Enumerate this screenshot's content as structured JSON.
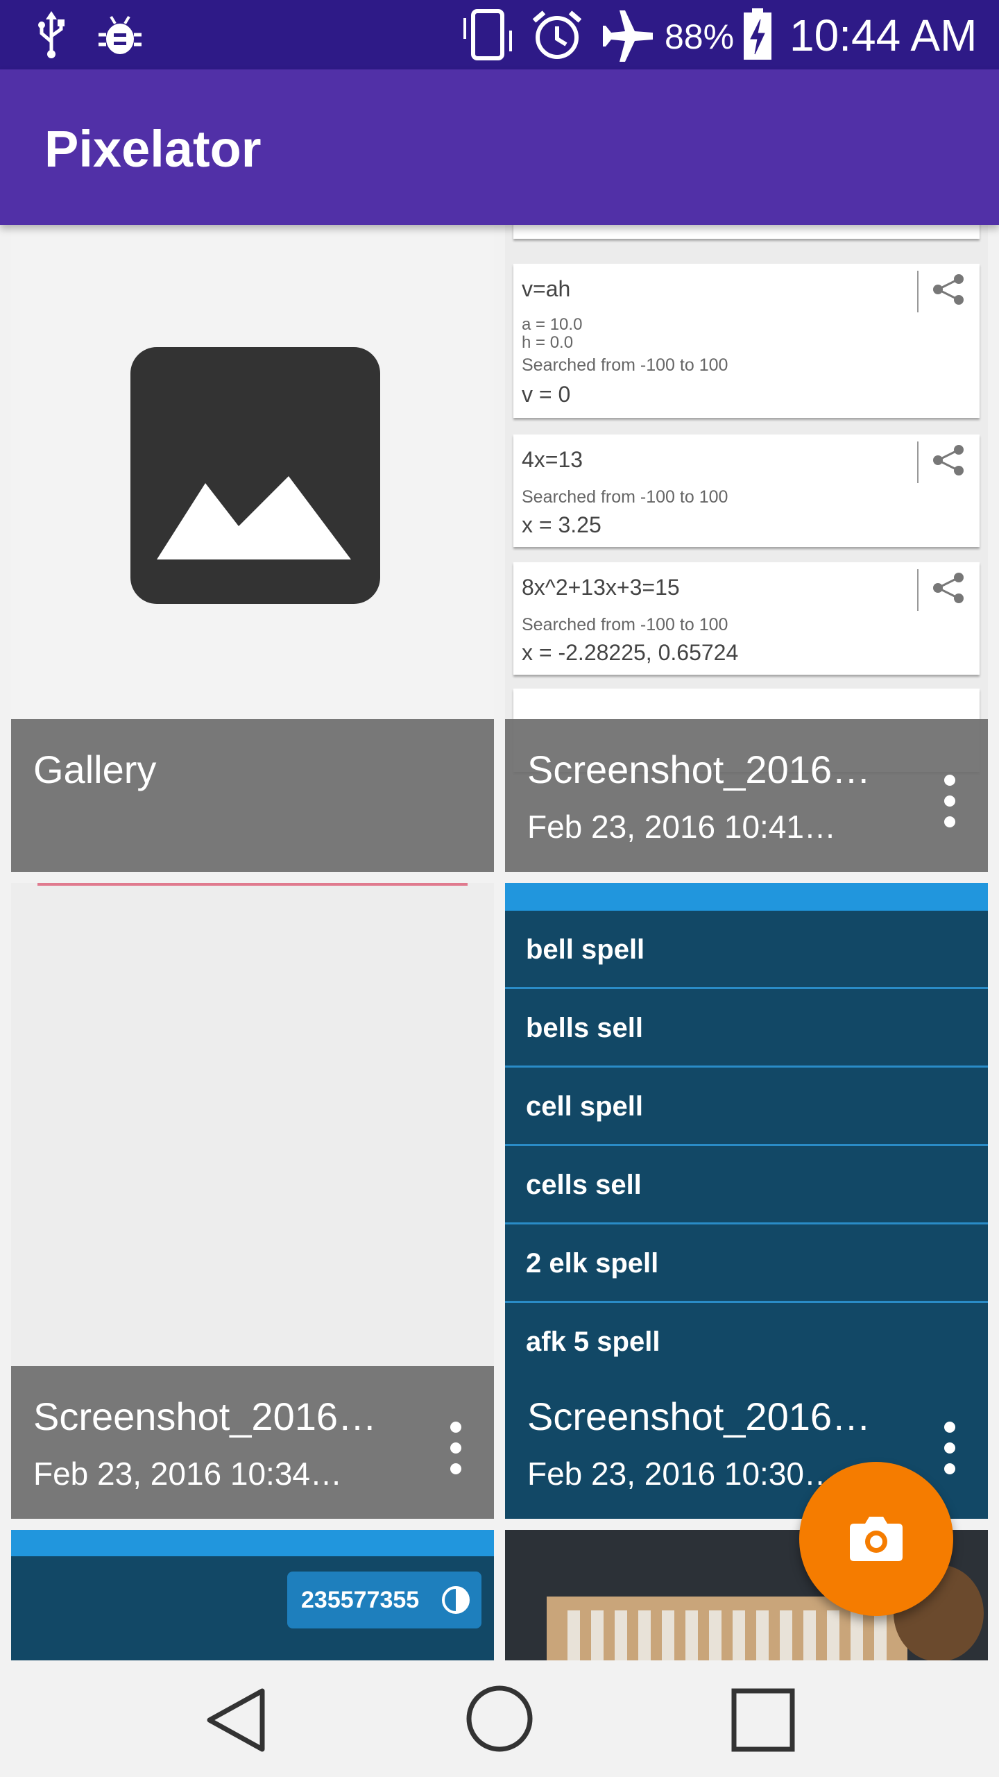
{
  "status_bar": {
    "battery": "88%",
    "time": "10:44 AM",
    "icons": [
      "usb-icon",
      "debug-icon",
      "vibrate-icon",
      "alarm-icon",
      "airplane-icon",
      "battery-charging-icon"
    ]
  },
  "app_bar": {
    "title": "Pixelator"
  },
  "gallery_tile": {
    "label": "Gallery",
    "icon": "image-icon"
  },
  "tiles": [
    {
      "title": "Screenshot_2016…",
      "date": "Feb 23, 2016 10:41…",
      "preview": {
        "cards": [
          {
            "equation": "v=ah",
            "vars": [
              "a = 10.0",
              "h = 0.0"
            ],
            "range": "Searched from -100 to 100",
            "result": "v = 0"
          },
          {
            "equation": "4x=13",
            "vars": [],
            "range": "Searched from -100 to 100",
            "result": "x = 3.25"
          },
          {
            "equation": "8x^2+13x+3=15",
            "vars": [],
            "range": "Searched from -100 to 100",
            "result": "x = -2.28225, 0.65724"
          }
        ]
      }
    },
    {
      "title": "Screenshot_2016…",
      "date": "Feb 23, 2016 10:34…"
    },
    {
      "title": "Screenshot_2016…",
      "date": "Feb 23, 2016 10:30…",
      "preview": {
        "rows": [
          "bell spell",
          "bells sell",
          "cell spell",
          "cells sell",
          "2 elk spell",
          "afk 5 spell"
        ]
      }
    },
    {
      "preview_badge": "235577355"
    }
  ],
  "colors": {
    "status_bar": "#2e1a87",
    "app_bar": "#5130a7",
    "fab": "#f57c00",
    "caption": "#6e6e6e"
  },
  "fab": {
    "icon": "camera-icon"
  },
  "nav_bar": {
    "icons": [
      "back-icon",
      "home-icon",
      "recents-icon"
    ]
  }
}
